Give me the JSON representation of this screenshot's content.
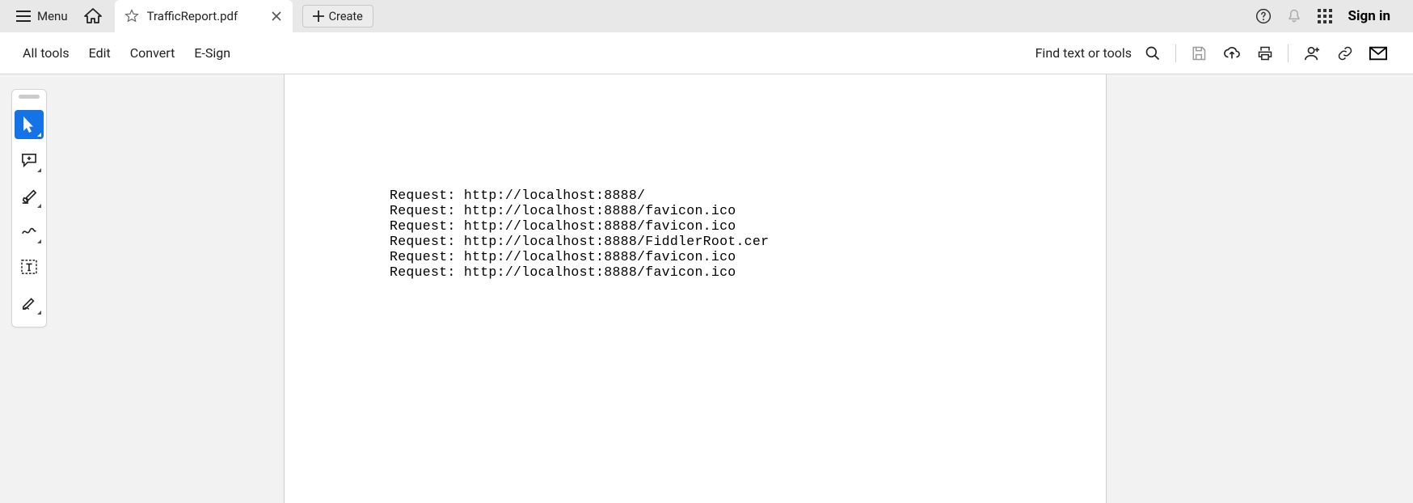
{
  "topbar": {
    "menu_label": "Menu",
    "tab_title": "TrafficReport.pdf",
    "create_label": "Create",
    "signin_label": "Sign in"
  },
  "toolbar": {
    "items": [
      "All tools",
      "Edit",
      "Convert",
      "E-Sign"
    ],
    "find_label": "Find text or tools"
  },
  "document": {
    "lines": [
      "Request: http://localhost:8888/",
      "Request: http://localhost:8888/favicon.ico",
      "Request: http://localhost:8888/favicon.ico",
      "Request: http://localhost:8888/FiddlerRoot.cer",
      "Request: http://localhost:8888/favicon.ico",
      "Request: http://localhost:8888/favicon.ico"
    ]
  }
}
